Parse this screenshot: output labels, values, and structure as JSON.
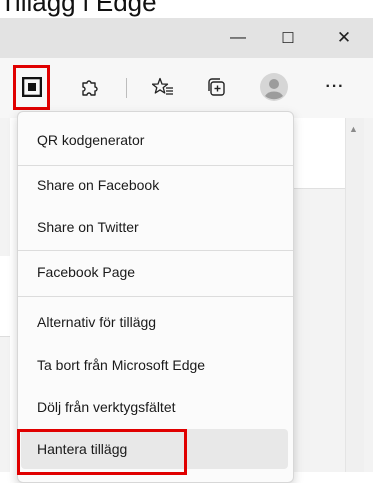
{
  "caption": {
    "text": "Tillägg i Edge"
  },
  "window": {
    "minimize": "—",
    "maximize": "☐",
    "close": "✕"
  },
  "toolbar": {
    "icons": [
      "qr-extension-icon",
      "puzzle-extensions-icon",
      "favorites-star-icon",
      "collections-icon",
      "profile-avatar-icon"
    ],
    "more_label": "···"
  },
  "menu": {
    "items": [
      {
        "label": "QR kodgenerator"
      },
      {
        "label": "Share on Facebook"
      },
      {
        "label": "Share on Twitter"
      },
      {
        "label": "Facebook Page"
      },
      {
        "label": "Alternativ för tillägg"
      },
      {
        "label": "Ta bort från Microsoft Edge"
      },
      {
        "label": "Dölj från verktygsfältet"
      },
      {
        "label": "Hantera tillägg"
      }
    ]
  },
  "colors": {
    "highlight": "#e00000",
    "titlebar": "#e3e3e3",
    "toolbar": "#f7f7f7"
  }
}
